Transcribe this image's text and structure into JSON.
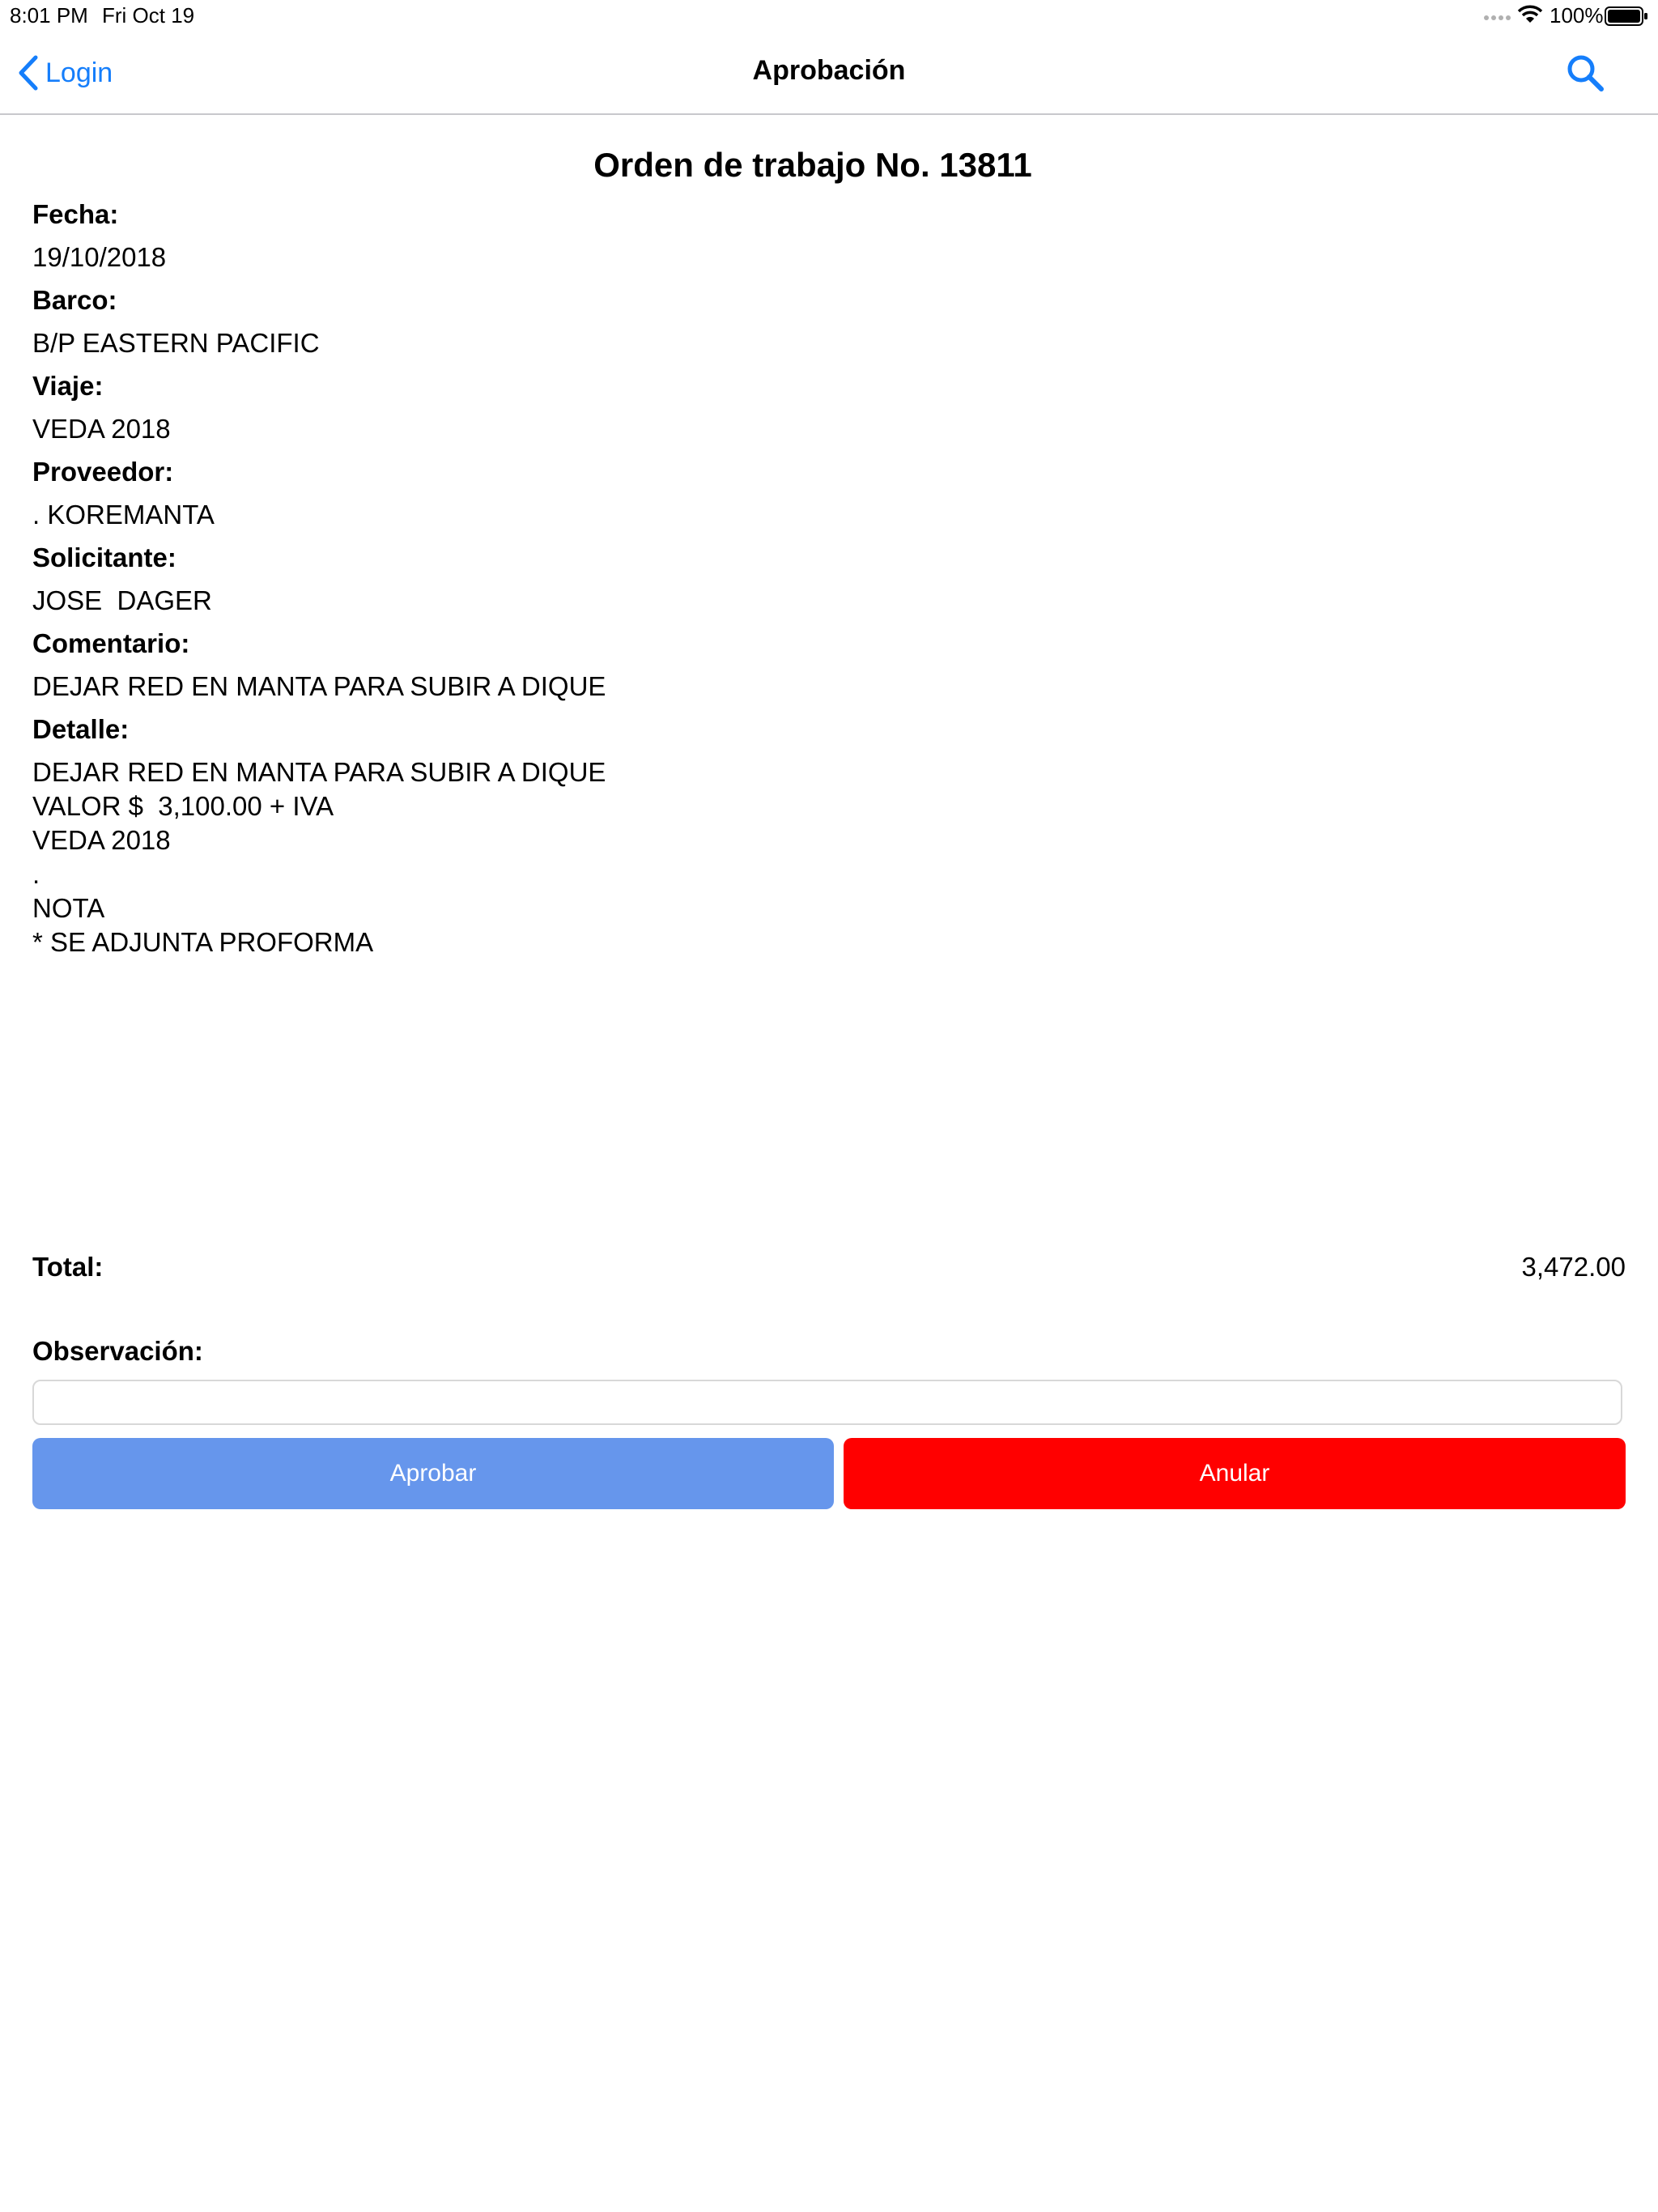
{
  "status_bar": {
    "time": "8:01 PM",
    "date": "Fri Oct 19",
    "battery": "100%"
  },
  "nav": {
    "back_label": "Login",
    "title": "Aprobación",
    "search_icon": "search-icon"
  },
  "order": {
    "title": "Orden de trabajo No. 13811",
    "fields": [
      {
        "label": "Fecha:",
        "value": "19/10/2018"
      },
      {
        "label": "Barco:",
        "value": "B/P EASTERN PACIFIC"
      },
      {
        "label": "Viaje:",
        "value": "VEDA 2018"
      },
      {
        "label": "Proveedor:",
        "value": ". KOREMANTA"
      },
      {
        "label": "Solicitante:",
        "value": "JOSE  DAGER"
      },
      {
        "label": "Comentario:",
        "value": "DEJAR RED EN MANTA PARA SUBIR A DIQUE"
      }
    ],
    "detail_label": "Detalle:",
    "detail_lines": [
      "DEJAR RED EN MANTA PARA SUBIR A DIQUE",
      "VALOR $  3,100.00 + IVA",
      "VEDA 2018",
      ".",
      "NOTA",
      "* SE ADJUNTA PROFORMA"
    ],
    "total_label": "Total:",
    "total_value": "3,472.00",
    "observation_label": "Observación:",
    "observation_value": ""
  },
  "buttons": {
    "approve": "Aprobar",
    "cancel": "Anular"
  },
  "colors": {
    "accent": "#157efb",
    "approve_bg": "#6696ec",
    "cancel_bg": "#ff0000"
  }
}
